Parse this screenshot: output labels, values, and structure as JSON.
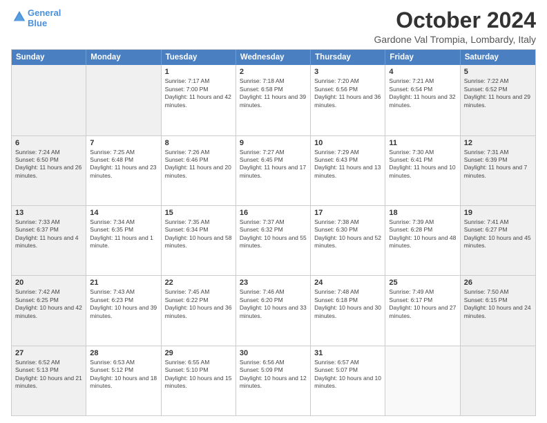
{
  "header": {
    "logo_line1": "General",
    "logo_line2": "Blue",
    "month": "October 2024",
    "location": "Gardone Val Trompia, Lombardy, Italy"
  },
  "days_of_week": [
    "Sunday",
    "Monday",
    "Tuesday",
    "Wednesday",
    "Thursday",
    "Friday",
    "Saturday"
  ],
  "weeks": [
    [
      {
        "num": "",
        "sunrise": "",
        "sunset": "",
        "daylight": "",
        "shaded": true
      },
      {
        "num": "",
        "sunrise": "",
        "sunset": "",
        "daylight": "",
        "shaded": true
      },
      {
        "num": "1",
        "sunrise": "Sunrise: 7:17 AM",
        "sunset": "Sunset: 7:00 PM",
        "daylight": "Daylight: 11 hours and 42 minutes.",
        "shaded": false
      },
      {
        "num": "2",
        "sunrise": "Sunrise: 7:18 AM",
        "sunset": "Sunset: 6:58 PM",
        "daylight": "Daylight: 11 hours and 39 minutes.",
        "shaded": false
      },
      {
        "num": "3",
        "sunrise": "Sunrise: 7:20 AM",
        "sunset": "Sunset: 6:56 PM",
        "daylight": "Daylight: 11 hours and 36 minutes.",
        "shaded": false
      },
      {
        "num": "4",
        "sunrise": "Sunrise: 7:21 AM",
        "sunset": "Sunset: 6:54 PM",
        "daylight": "Daylight: 11 hours and 32 minutes.",
        "shaded": false
      },
      {
        "num": "5",
        "sunrise": "Sunrise: 7:22 AM",
        "sunset": "Sunset: 6:52 PM",
        "daylight": "Daylight: 11 hours and 29 minutes.",
        "shaded": true
      }
    ],
    [
      {
        "num": "6",
        "sunrise": "Sunrise: 7:24 AM",
        "sunset": "Sunset: 6:50 PM",
        "daylight": "Daylight: 11 hours and 26 minutes.",
        "shaded": true
      },
      {
        "num": "7",
        "sunrise": "Sunrise: 7:25 AM",
        "sunset": "Sunset: 6:48 PM",
        "daylight": "Daylight: 11 hours and 23 minutes.",
        "shaded": false
      },
      {
        "num": "8",
        "sunrise": "Sunrise: 7:26 AM",
        "sunset": "Sunset: 6:46 PM",
        "daylight": "Daylight: 11 hours and 20 minutes.",
        "shaded": false
      },
      {
        "num": "9",
        "sunrise": "Sunrise: 7:27 AM",
        "sunset": "Sunset: 6:45 PM",
        "daylight": "Daylight: 11 hours and 17 minutes.",
        "shaded": false
      },
      {
        "num": "10",
        "sunrise": "Sunrise: 7:29 AM",
        "sunset": "Sunset: 6:43 PM",
        "daylight": "Daylight: 11 hours and 13 minutes.",
        "shaded": false
      },
      {
        "num": "11",
        "sunrise": "Sunrise: 7:30 AM",
        "sunset": "Sunset: 6:41 PM",
        "daylight": "Daylight: 11 hours and 10 minutes.",
        "shaded": false
      },
      {
        "num": "12",
        "sunrise": "Sunrise: 7:31 AM",
        "sunset": "Sunset: 6:39 PM",
        "daylight": "Daylight: 11 hours and 7 minutes.",
        "shaded": true
      }
    ],
    [
      {
        "num": "13",
        "sunrise": "Sunrise: 7:33 AM",
        "sunset": "Sunset: 6:37 PM",
        "daylight": "Daylight: 11 hours and 4 minutes.",
        "shaded": true
      },
      {
        "num": "14",
        "sunrise": "Sunrise: 7:34 AM",
        "sunset": "Sunset: 6:35 PM",
        "daylight": "Daylight: 11 hours and 1 minute.",
        "shaded": false
      },
      {
        "num": "15",
        "sunrise": "Sunrise: 7:35 AM",
        "sunset": "Sunset: 6:34 PM",
        "daylight": "Daylight: 10 hours and 58 minutes.",
        "shaded": false
      },
      {
        "num": "16",
        "sunrise": "Sunrise: 7:37 AM",
        "sunset": "Sunset: 6:32 PM",
        "daylight": "Daylight: 10 hours and 55 minutes.",
        "shaded": false
      },
      {
        "num": "17",
        "sunrise": "Sunrise: 7:38 AM",
        "sunset": "Sunset: 6:30 PM",
        "daylight": "Daylight: 10 hours and 52 minutes.",
        "shaded": false
      },
      {
        "num": "18",
        "sunrise": "Sunrise: 7:39 AM",
        "sunset": "Sunset: 6:28 PM",
        "daylight": "Daylight: 10 hours and 48 minutes.",
        "shaded": false
      },
      {
        "num": "19",
        "sunrise": "Sunrise: 7:41 AM",
        "sunset": "Sunset: 6:27 PM",
        "daylight": "Daylight: 10 hours and 45 minutes.",
        "shaded": true
      }
    ],
    [
      {
        "num": "20",
        "sunrise": "Sunrise: 7:42 AM",
        "sunset": "Sunset: 6:25 PM",
        "daylight": "Daylight: 10 hours and 42 minutes.",
        "shaded": true
      },
      {
        "num": "21",
        "sunrise": "Sunrise: 7:43 AM",
        "sunset": "Sunset: 6:23 PM",
        "daylight": "Daylight: 10 hours and 39 minutes.",
        "shaded": false
      },
      {
        "num": "22",
        "sunrise": "Sunrise: 7:45 AM",
        "sunset": "Sunset: 6:22 PM",
        "daylight": "Daylight: 10 hours and 36 minutes.",
        "shaded": false
      },
      {
        "num": "23",
        "sunrise": "Sunrise: 7:46 AM",
        "sunset": "Sunset: 6:20 PM",
        "daylight": "Daylight: 10 hours and 33 minutes.",
        "shaded": false
      },
      {
        "num": "24",
        "sunrise": "Sunrise: 7:48 AM",
        "sunset": "Sunset: 6:18 PM",
        "daylight": "Daylight: 10 hours and 30 minutes.",
        "shaded": false
      },
      {
        "num": "25",
        "sunrise": "Sunrise: 7:49 AM",
        "sunset": "Sunset: 6:17 PM",
        "daylight": "Daylight: 10 hours and 27 minutes.",
        "shaded": false
      },
      {
        "num": "26",
        "sunrise": "Sunrise: 7:50 AM",
        "sunset": "Sunset: 6:15 PM",
        "daylight": "Daylight: 10 hours and 24 minutes.",
        "shaded": true
      }
    ],
    [
      {
        "num": "27",
        "sunrise": "Sunrise: 6:52 AM",
        "sunset": "Sunset: 5:13 PM",
        "daylight": "Daylight: 10 hours and 21 minutes.",
        "shaded": true
      },
      {
        "num": "28",
        "sunrise": "Sunrise: 6:53 AM",
        "sunset": "Sunset: 5:12 PM",
        "daylight": "Daylight: 10 hours and 18 minutes.",
        "shaded": false
      },
      {
        "num": "29",
        "sunrise": "Sunrise: 6:55 AM",
        "sunset": "Sunset: 5:10 PM",
        "daylight": "Daylight: 10 hours and 15 minutes.",
        "shaded": false
      },
      {
        "num": "30",
        "sunrise": "Sunrise: 6:56 AM",
        "sunset": "Sunset: 5:09 PM",
        "daylight": "Daylight: 10 hours and 12 minutes.",
        "shaded": false
      },
      {
        "num": "31",
        "sunrise": "Sunrise: 6:57 AM",
        "sunset": "Sunset: 5:07 PM",
        "daylight": "Daylight: 10 hours and 10 minutes.",
        "shaded": false
      },
      {
        "num": "",
        "sunrise": "",
        "sunset": "",
        "daylight": "",
        "shaded": false
      },
      {
        "num": "",
        "sunrise": "",
        "sunset": "",
        "daylight": "",
        "shaded": true
      }
    ]
  ]
}
